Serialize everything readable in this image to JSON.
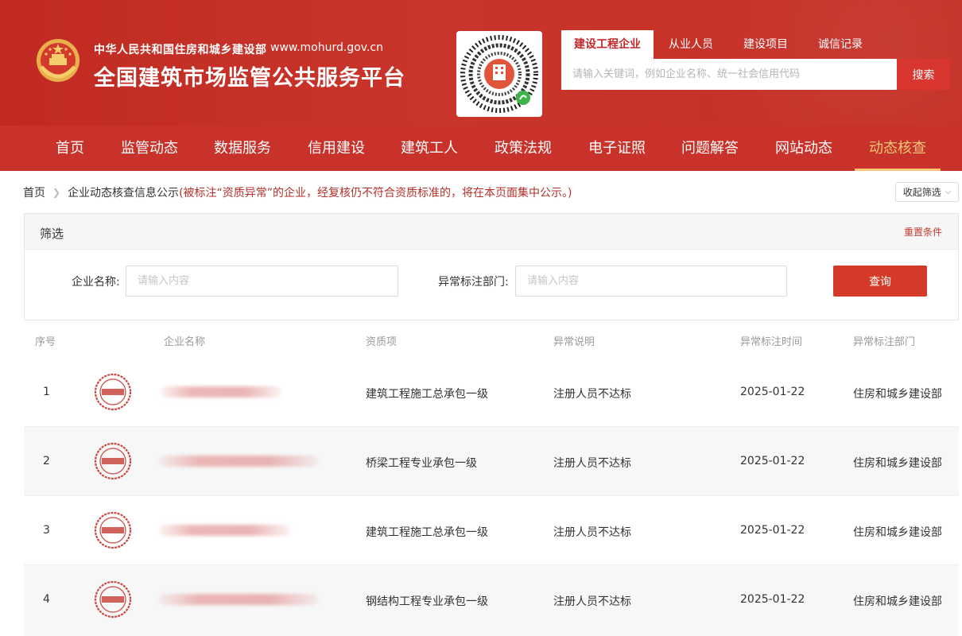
{
  "header": {
    "gov_name": "中华人民共和国住房和城乡建设部",
    "gov_url": "www.mohurd.gov.cn",
    "site_title": "全国建筑市场监管公共服务平台",
    "emblem_icon": "national-emblem-icon",
    "qr_icon": "mini-program-qr-code-icon"
  },
  "search": {
    "tabs": [
      {
        "label": "建设工程企业",
        "active": true
      },
      {
        "label": "从业人员",
        "active": false
      },
      {
        "label": "建设项目",
        "active": false
      },
      {
        "label": "诚信记录",
        "active": false
      }
    ],
    "placeholder": "请输入关键词，例如企业名称、统一社会信用代码",
    "button_label": "搜索"
  },
  "nav": {
    "items": [
      {
        "label": "首页"
      },
      {
        "label": "监管动态"
      },
      {
        "label": "数据服务"
      },
      {
        "label": "信用建设"
      },
      {
        "label": "建筑工人"
      },
      {
        "label": "政策法规"
      },
      {
        "label": "电子证照"
      },
      {
        "label": "问题解答"
      },
      {
        "label": "网站动态"
      },
      {
        "label": "动态核查",
        "active": true
      }
    ]
  },
  "breadcrumb": {
    "home": "首页",
    "current": "企业动态核查信息公示",
    "note": "(被标注“资质异常”的企业，经复核仍不符合资质标准的，将在本页面集中公示。)",
    "collapse_label": "收起筛选"
  },
  "filter": {
    "title": "筛选",
    "reset_label": "重置条件",
    "company_label": "企业名称:",
    "company_placeholder": "请输入内容",
    "dept_label": "异常标注部门:",
    "dept_placeholder": "请输入内容",
    "query_label": "查询"
  },
  "table": {
    "headers": [
      "序号",
      "企业名称",
      "资质项",
      "异常说明",
      "异常标注时间",
      "异常标注部门"
    ],
    "stamp_icon": "qualification-abnormal-stamp-icon",
    "rows": [
      {
        "index": "1",
        "qualification": "建筑工程施工总承包一级",
        "description": "注册人员不达标",
        "date": "2025-01-22",
        "department": "住房和城乡建设部"
      },
      {
        "index": "2",
        "qualification": "桥梁工程专业承包一级",
        "description": "注册人员不达标",
        "date": "2025-01-22",
        "department": "住房和城乡建设部"
      },
      {
        "index": "3",
        "qualification": "建筑工程施工总承包一级",
        "description": "注册人员不达标",
        "date": "2025-01-22",
        "department": "住房和城乡建设部"
      },
      {
        "index": "4",
        "qualification": "钢结构工程专业承包一级",
        "description": "注册人员不达标",
        "date": "2025-01-22",
        "department": "住房和城乡建设部"
      }
    ]
  },
  "colors": {
    "brand_red": "#c8322a",
    "active_gold": "#f3c774",
    "button_red": "#d33b28"
  }
}
